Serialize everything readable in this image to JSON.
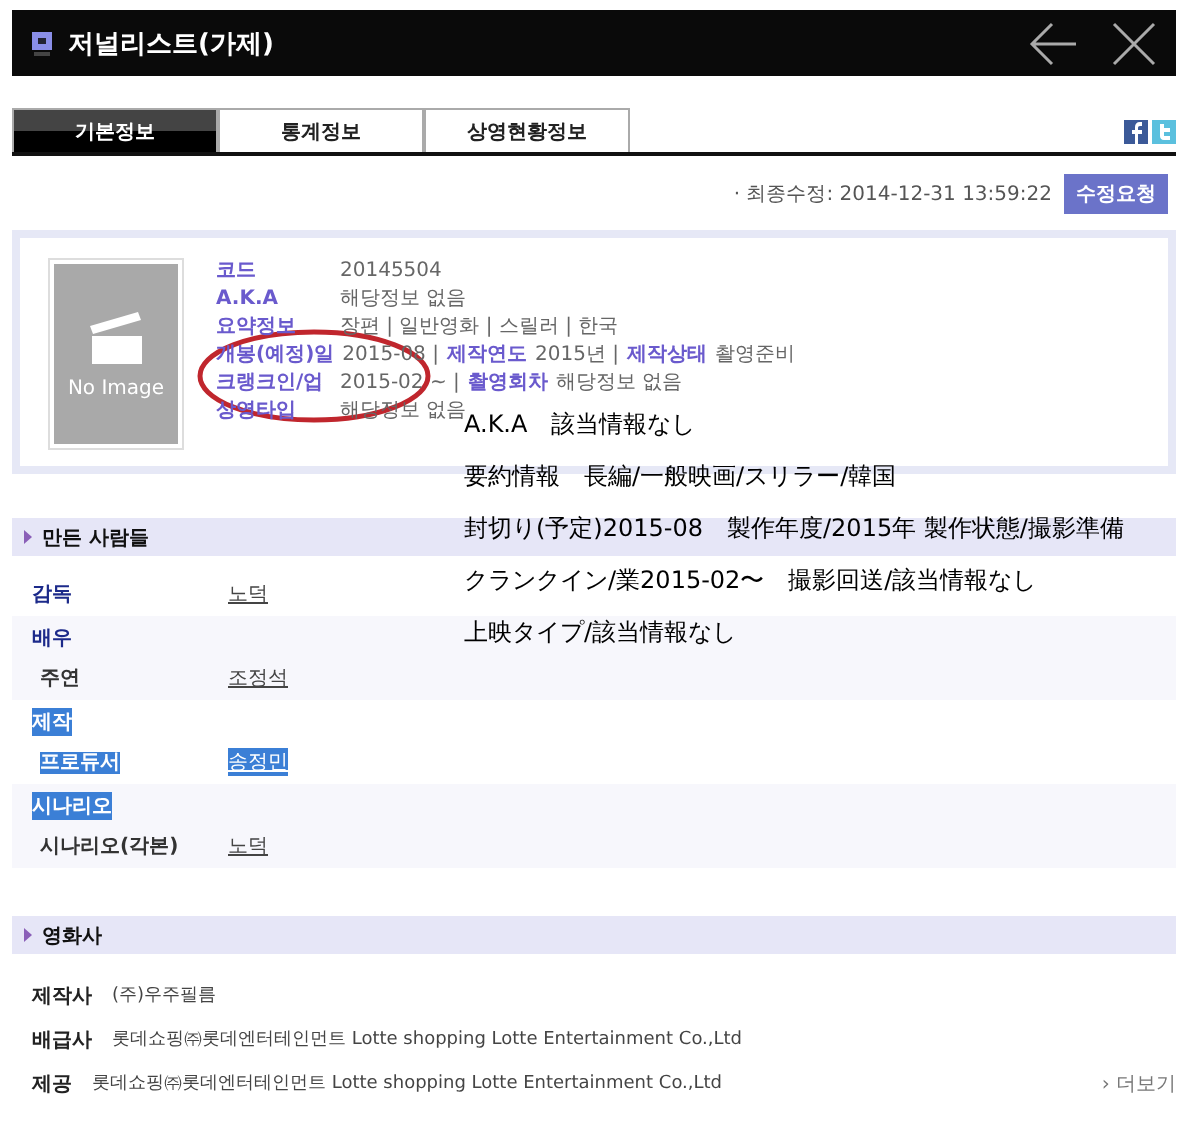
{
  "window": {
    "title": "저널리스트(가제)"
  },
  "tabs": [
    {
      "label": "기본정보",
      "selected": true
    },
    {
      "label": "통계정보",
      "selected": false
    },
    {
      "label": "상영현황정보",
      "selected": false
    }
  ],
  "last_modified": "· 최종수정: 2014-12-31 13:59:22",
  "edit_button": "수정요청",
  "info": {
    "poster": "No Image",
    "rows": [
      {
        "parts": [
          {
            "label": "코드",
            "value": "20145504"
          }
        ]
      },
      {
        "parts": [
          {
            "label": "A.K.A",
            "value": "해당정보 없음"
          }
        ]
      },
      {
        "parts": [
          {
            "label": "요약정보",
            "value": "장편 | 일반영화 | 스릴러 | 한국"
          }
        ]
      },
      {
        "parts": [
          {
            "label": "개봉(예정)일",
            "value": "2015-08 |"
          },
          {
            "label": "제작연도",
            "value": "2015년 |"
          },
          {
            "label": "제작상태",
            "value": "촬영준비"
          }
        ]
      },
      {
        "parts": [
          {
            "label": "크랭크인/업",
            "value": "2015-02 ~ |"
          },
          {
            "label": "촬영회차",
            "value": "해당정보 없음"
          }
        ]
      },
      {
        "parts": [
          {
            "label": "상영타입",
            "value": "해당정보 없음"
          }
        ]
      }
    ]
  },
  "people": {
    "title": "만든 사람들",
    "groups": [
      {
        "title": "감독",
        "value": "노덕",
        "highlighted": false
      },
      {
        "title": "배우",
        "highlighted": false,
        "members": [
          {
            "role": "주연",
            "name": "조정석",
            "highlighted": false
          }
        ]
      },
      {
        "title": "제작",
        "highlighted": true,
        "members": [
          {
            "role": "프로듀서",
            "name": "송정민",
            "highlighted": true
          }
        ]
      },
      {
        "title": "시나리오",
        "highlighted": true,
        "members": [
          {
            "role": "시나리오(각본)",
            "name": "노덕",
            "highlighted": false
          }
        ]
      }
    ]
  },
  "companies": {
    "title": "영화사",
    "rows": [
      {
        "label": "제작사",
        "value": "(주)우주필름"
      },
      {
        "label": "배급사",
        "value": "롯데쇼핑㈜롯데엔터테인먼트 Lotte shopping Lotte Entertainment Co.,Ltd"
      },
      {
        "label": "제공",
        "value": "롯데쇼핑㈜롯데엔터테인먼트 Lotte shopping Lotte Entertainment Co.,Ltd"
      }
    ],
    "more_link": "› 더보기"
  },
  "note": {
    "lines": [
      "A.K.A　該当情報なし",
      "要約情報　長編/一般映画/スリラー/韓国",
      "封切り(予定)2015-08　製作年度/2015年 製作状態/撮影準備",
      "クランクイン/業2015-02〜　撮影回送/該当情報なし",
      "上映タイプ/該当情報なし"
    ]
  }
}
